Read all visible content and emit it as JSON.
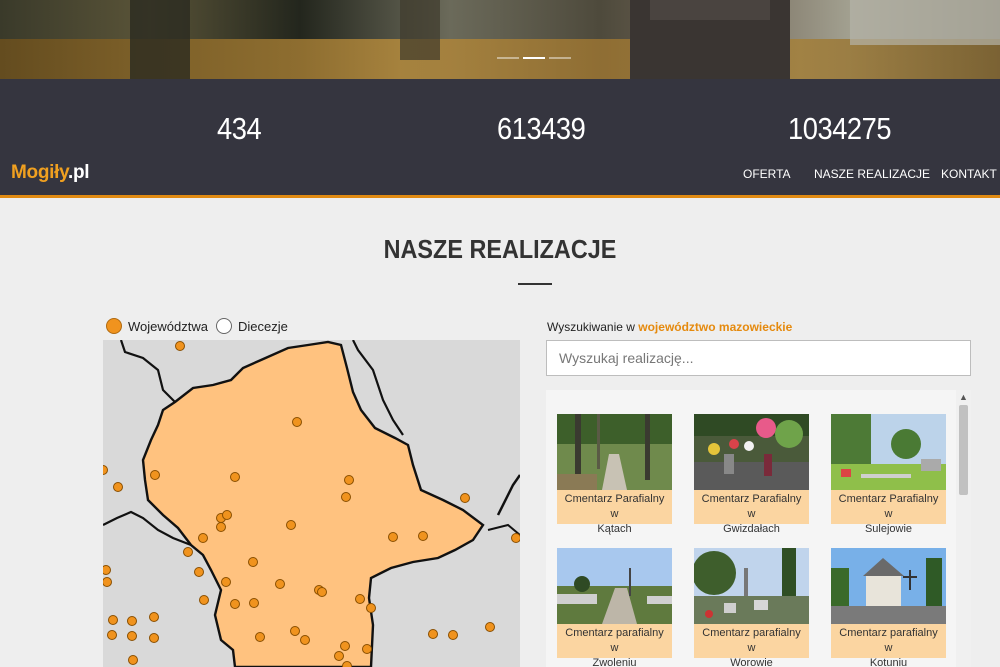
{
  "hero": {
    "slides": 3,
    "active_slide": 2
  },
  "stats": [
    "434",
    "613439",
    "1034275"
  ],
  "logo": {
    "name": "Mogiły",
    "tld": ".pl"
  },
  "nav": [
    "OFERTA",
    "NASZE REALIZACJE",
    "KONTAKT"
  ],
  "section": {
    "title": "NASZE REALIZACJE"
  },
  "map_toggle": {
    "option1": "Województwa",
    "option2": "Diecezje",
    "selected": "Województwa"
  },
  "search": {
    "label_prefix": "Wyszukiwanie w",
    "region": "województwo mazowieckie",
    "placeholder": "Wyszukaj realizację..."
  },
  "results": [
    {
      "line1": "Cmentarz Parafialny w",
      "line2": "Kątach"
    },
    {
      "line1": "Cmentarz Parafialny w",
      "line2": "Gwizdałach"
    },
    {
      "line1": "Cmentarz Parafialny w",
      "line2": "Sulejowie"
    },
    {
      "line1": "Cmentarz parafialny w",
      "line2": "Zwoleniu"
    },
    {
      "line1": "Cmentarz parafialny w",
      "line2": "Worowie"
    },
    {
      "line1": "Cmentarz parafialny w",
      "line2": "Kotuniu"
    }
  ],
  "colors": {
    "accent": "#e58a0e",
    "band": "#35353f",
    "caption_bg": "#fbd5a1",
    "region_fill": "#ffc27f",
    "marker": "#f0931e"
  }
}
